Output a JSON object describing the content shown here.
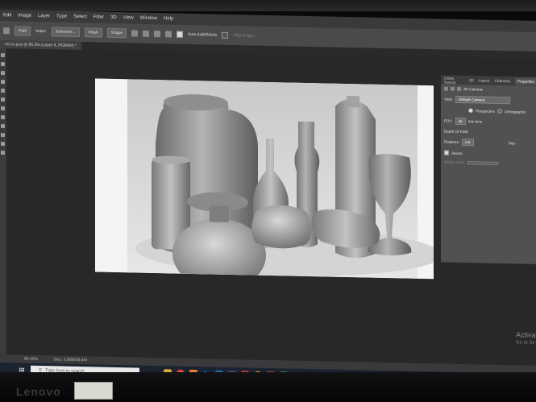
{
  "menubar": {
    "items": [
      "Edit",
      "Image",
      "Layer",
      "Type",
      "Select",
      "Filter",
      "3D",
      "View",
      "Window",
      "Help"
    ]
  },
  "options": {
    "path_mode": "Path",
    "make_label": "Make:",
    "selection_label": "Selection...",
    "mask_label": "Mask",
    "shape_label": "Shape",
    "auto_add_delete": "Auto Add/Delete",
    "align_edges": "Align Edges"
  },
  "document": {
    "tab_title": "ms to.psd @ 85.5% (Layer 8, RGB/8#) *"
  },
  "panel": {
    "tabs": [
      "Clone Source",
      "3D",
      "Layers",
      "Channels",
      "Properties"
    ],
    "active_tab": "Properties",
    "section_title": "3D Camera",
    "view_label": "View:",
    "view_value": "Default Camera",
    "perspective_label": "Perspective",
    "orthographic_label": "Orthographic",
    "fov_label": "FOV:",
    "fov_value": "36",
    "fov_unit": "mm lens",
    "depth_label": "Depth Of Field",
    "distance_label": "Distance:",
    "distance_value": "0.5",
    "depth_short": "Dep",
    "stereo_label": "Stereo",
    "stereo_view_label": "Stereo View:"
  },
  "status": {
    "zoom": "85.45%",
    "doc_info": "Doc: 3.66M/36.4M"
  },
  "taskbar": {
    "search_placeholder": "Type here to search",
    "apps": [
      "file-explorer-icon",
      "chrome-icon",
      "vlc-icon",
      "photoshop-icon",
      "vectorworks-icon",
      "sketchup-icon",
      "files-icon",
      "chat-icon",
      "mail-icon",
      "game-icon"
    ]
  },
  "watermark": {
    "line1": "Activat",
    "line2": "Go to Se"
  },
  "brand": "Lenovo"
}
